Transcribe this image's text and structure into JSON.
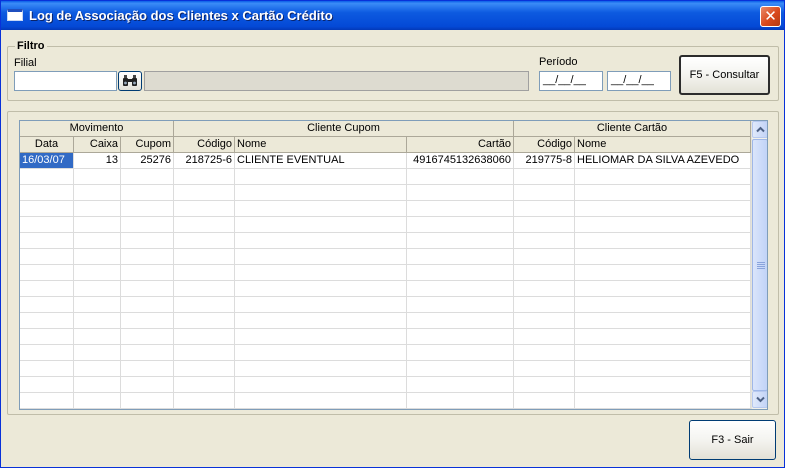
{
  "window": {
    "title": "Log de Associação dos Clientes x Cartão Crédito",
    "close_symbol": "✕"
  },
  "filter": {
    "group_label": "Filtro",
    "filial_label": "Filial",
    "filial_value": "",
    "filial_description": "",
    "periodo_label": "Período",
    "date_from": "__/__/__",
    "date_to": "__/__/__",
    "consult_button": "F5 - Consultar"
  },
  "grid": {
    "groups": [
      {
        "label": "Movimento"
      },
      {
        "label": "Cliente Cupom"
      },
      {
        "label": "Cliente Cartão"
      }
    ],
    "columns": [
      "Data",
      "Caixa",
      "Cupom",
      "Código",
      "Nome",
      "Cartão",
      "Código",
      "Nome"
    ],
    "rows": [
      {
        "data": "16/03/07",
        "caixa": "13",
        "cupom": "25276",
        "codigo_cupom": "218725-6",
        "nome_cupom": "CLIENTE EVENTUAL",
        "cartao": "4916745132638060",
        "codigo_cartao": "219775-8",
        "nome_cartao": "HELIOMAR DA SILVA AZEVEDO"
      }
    ]
  },
  "footer": {
    "exit_button": "F3 - Sair"
  },
  "icons": {
    "search": "binoculars-icon",
    "close": "close-icon"
  }
}
